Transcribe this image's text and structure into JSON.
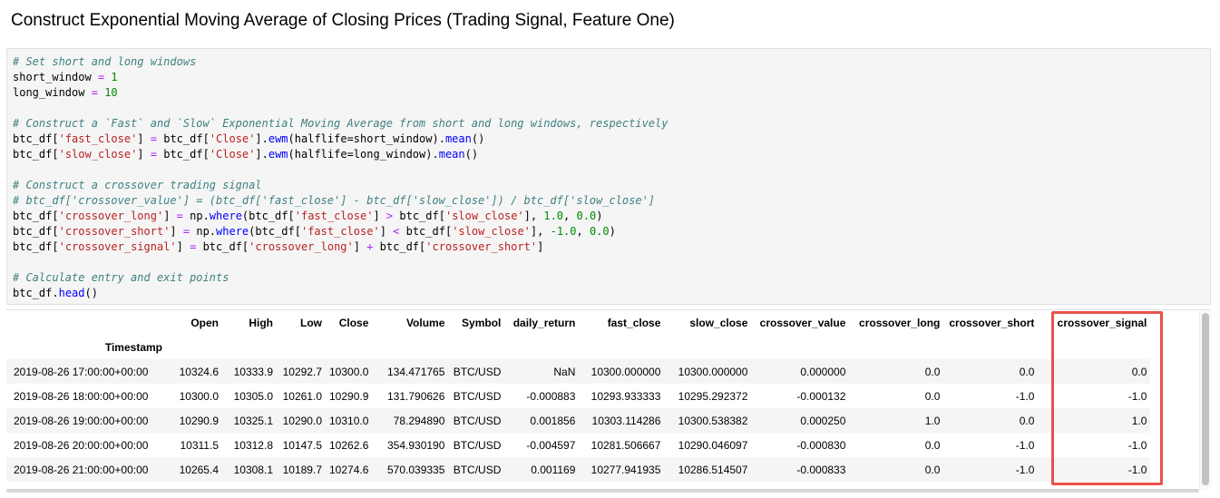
{
  "heading": "Construct Exponential Moving Average of Closing Prices (Trading Signal, Feature One)",
  "code": {
    "comment_windows": "# Set short and long windows",
    "short_var": "short_window",
    "short_val": "1",
    "long_var": "long_window",
    "long_val": "10",
    "comment_ema": "# Construct a `Fast` and `Slow` Exponential Moving Average from short and long windows, respectively",
    "comment_signal": "# Construct a crossover trading signal",
    "comment_value": "# btc_df['crossover_value'] = (btc_df['fast_close'] - btc_df['slow_close']) / btc_df['slow_close']",
    "comment_entry": "# Calculate entry and exit points",
    "df": "btc_df",
    "np": "np",
    "where": "where",
    "ewm": "ewm",
    "mean": "mean",
    "head": "head",
    "s_fast_close": "'fast_close'",
    "s_slow_close": "'slow_close'",
    "s_close": "'Close'",
    "s_crossover_long": "'crossover_long'",
    "s_crossover_short": "'crossover_short'",
    "s_crossover_signal": "'crossover_signal'",
    "halflife_short": "halflife=short_window",
    "halflife_long": "halflife=long_window",
    "one": "1.0",
    "zero": "0.0",
    "neg_one": "-1.0"
  },
  "table": {
    "columns": [
      "Open",
      "High",
      "Low",
      "Close",
      "Volume",
      "Symbol",
      "daily_return",
      "fast_close",
      "slow_close",
      "crossover_value",
      "crossover_long",
      "crossover_short",
      "crossover_signal"
    ],
    "index_name": "Timestamp",
    "rows": [
      {
        "ts": "2019-08-26 17:00:00+00:00",
        "cells": [
          "10324.6",
          "10333.9",
          "10292.7",
          "10300.0",
          "134.471765",
          "BTC/USD",
          "NaN",
          "10300.000000",
          "10300.000000",
          "0.000000",
          "0.0",
          "0.0",
          "0.0"
        ]
      },
      {
        "ts": "2019-08-26 18:00:00+00:00",
        "cells": [
          "10300.0",
          "10305.0",
          "10261.0",
          "10290.9",
          "131.790626",
          "BTC/USD",
          "-0.000883",
          "10293.933333",
          "10295.292372",
          "-0.000132",
          "0.0",
          "-1.0",
          "-1.0"
        ]
      },
      {
        "ts": "2019-08-26 19:00:00+00:00",
        "cells": [
          "10290.9",
          "10325.1",
          "10290.0",
          "10310.0",
          "78.294890",
          "BTC/USD",
          "0.001856",
          "10303.114286",
          "10300.538382",
          "0.000250",
          "1.0",
          "0.0",
          "1.0"
        ]
      },
      {
        "ts": "2019-08-26 20:00:00+00:00",
        "cells": [
          "10311.5",
          "10312.8",
          "10147.5",
          "10262.6",
          "354.930190",
          "BTC/USD",
          "-0.004597",
          "10281.506667",
          "10290.046097",
          "-0.000830",
          "0.0",
          "-1.0",
          "-1.0"
        ]
      },
      {
        "ts": "2019-08-26 21:00:00+00:00",
        "cells": [
          "10265.4",
          "10308.1",
          "10189.7",
          "10274.6",
          "570.039335",
          "BTC/USD",
          "0.001169",
          "10277.941935",
          "10286.514507",
          "-0.000833",
          "0.0",
          "-1.0",
          "-1.0"
        ]
      }
    ]
  },
  "colors": {
    "highlight": "#e8524a",
    "comment": "#408080",
    "string": "#ba2121",
    "number": "#008800"
  }
}
